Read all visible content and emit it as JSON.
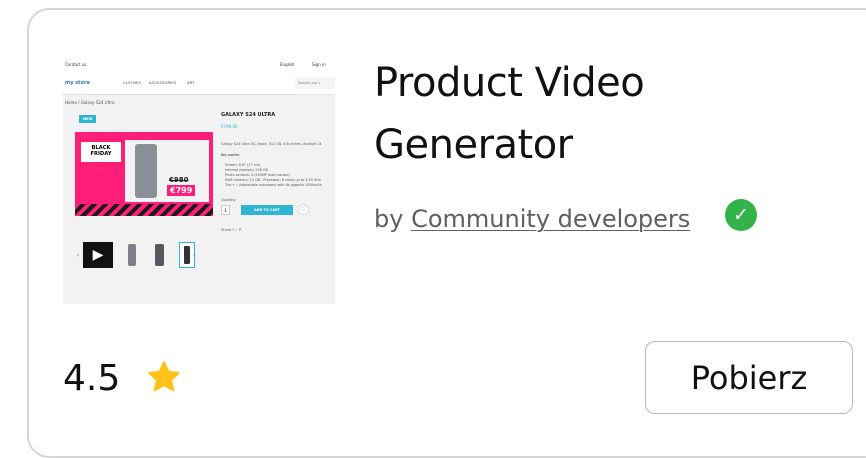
{
  "card": {
    "title_line1": "Product Video",
    "title_line2": "Generator",
    "by": "by ",
    "author": "Community developers",
    "verified_icon": "check-icon",
    "rating": "4.5",
    "rating_icon": "star-icon",
    "download_label": "Pobierz"
  },
  "thumbnail": {
    "contact": "Contact us",
    "language": "English",
    "sign_in": "Sign in",
    "logo": "my store",
    "menu": [
      "CLOTHES",
      "ACCESSORIES",
      "ART"
    ],
    "search_placeholder": "Search our c",
    "breadcrumb": "Home / Galaxy S24 Ultra",
    "badge": "NEW",
    "promo_line1": "BLACK",
    "promo_line2": "FRIDAY",
    "old_price": "€980",
    "new_price": "€799",
    "product_title": "GALAXY S24 ULTRA",
    "product_price": "€799.00",
    "description": "Galaxy S24 Ultra 5G, black, 512 GB, 6.8 inches, Android 14",
    "key_points_label": "Key points:",
    "key_points": [
      "Screen: 6.8\" (17 cm)",
      "Internal memory: 256 GB",
      "Photo sensors: 5 (200MP main sensor)",
      "RAM memory: 12 GB - Processor: 8 cores up to 3.39 GHz",
      "The + : Unbeatable autonomy with its gigantic 5000mAh"
    ],
    "quantity_label": "Quantity",
    "quantity": "1",
    "add_to_cart": "ADD TO CART",
    "share_label": "Share"
  }
}
